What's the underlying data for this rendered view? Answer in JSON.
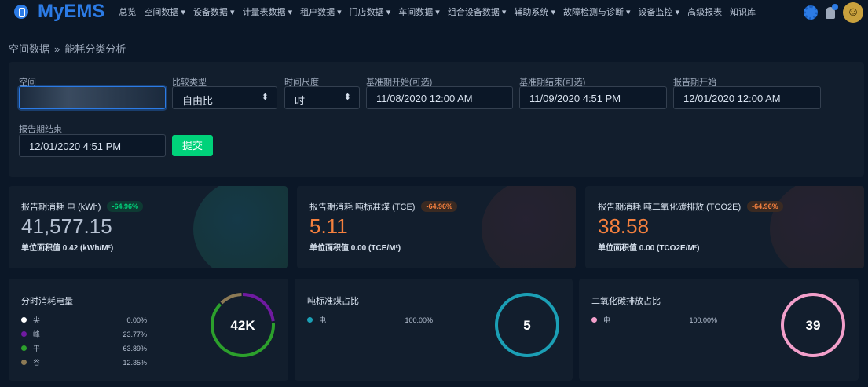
{
  "brand": "MyEMS",
  "menu": [
    "总览",
    "空间数据 ▾",
    "设备数据 ▾",
    "计量表数据 ▾",
    "租户数据 ▾",
    "门店数据 ▾",
    "车间数据 ▾",
    "组合设备数据 ▾",
    "辅助系统 ▾",
    "故障检测与诊断 ▾",
    "设备监控 ▾",
    "高级报表",
    "知识库"
  ],
  "breadcrumb": [
    "空间数据",
    "能耗分类分析"
  ],
  "breadcrumb_sep": "»",
  "filters": {
    "space_label": "空间",
    "space_value": "",
    "compare_label": "比较类型",
    "compare_value": "自由比",
    "period_label": "时间尺度",
    "period_value": "时",
    "base_start_label": "基准期开始(可选)",
    "base_start_value": "11/08/2020 12:00 AM",
    "base_end_label": "基准期结束(可选)",
    "base_end_value": "11/09/2020 4:51 PM",
    "report_start_label": "报告期开始",
    "report_start_value": "12/01/2020 12:00 AM",
    "report_end_label": "报告期结束",
    "report_end_value": "12/01/2020 4:51 PM",
    "submit": "提交"
  },
  "stats": [
    {
      "title": "报告期消耗 电 (kWh)",
      "badge": "-64.96%",
      "value": "41,577.15",
      "sub": "单位面积值 0.42 (kWh/M²)",
      "color": "#b6c1d2"
    },
    {
      "title": "报告期消耗 吨标准煤 (TCE)",
      "badge": "-64.96%",
      "value": "5.11",
      "sub": "单位面积值 0.00 (TCE/M²)",
      "color": "#f5803e"
    },
    {
      "title": "报告期消耗 吨二氧化碳排放 (TCO2E)",
      "badge": "-64.96%",
      "value": "38.58",
      "sub": "单位面积值 0.00 (TCO2E/M²)",
      "color": "#f5803e"
    }
  ],
  "panels": [
    {
      "title": "分时消耗电量",
      "center": "42K",
      "items": [
        {
          "label": "尖",
          "pct": "0.00%",
          "value": 0,
          "color": "#ffffff"
        },
        {
          "label": "峰",
          "pct": "23.77%",
          "value": 23.77,
          "color": "#6f1aa0"
        },
        {
          "label": "平",
          "pct": "63.89%",
          "value": 63.89,
          "color": "#2ca02c"
        },
        {
          "label": "谷",
          "pct": "12.35%",
          "value": 12.35,
          "color": "#8c7a55"
        }
      ]
    },
    {
      "title": "吨标准煤占比",
      "center": "5",
      "items": [
        {
          "label": "电",
          "pct": "100.00%",
          "value": 100,
          "color": "#1b9fb5"
        }
      ]
    },
    {
      "title": "二氧化碳排放占比",
      "center": "39",
      "items": [
        {
          "label": "电",
          "pct": "100.00%",
          "value": 100,
          "color": "#f29fca"
        }
      ]
    }
  ]
}
